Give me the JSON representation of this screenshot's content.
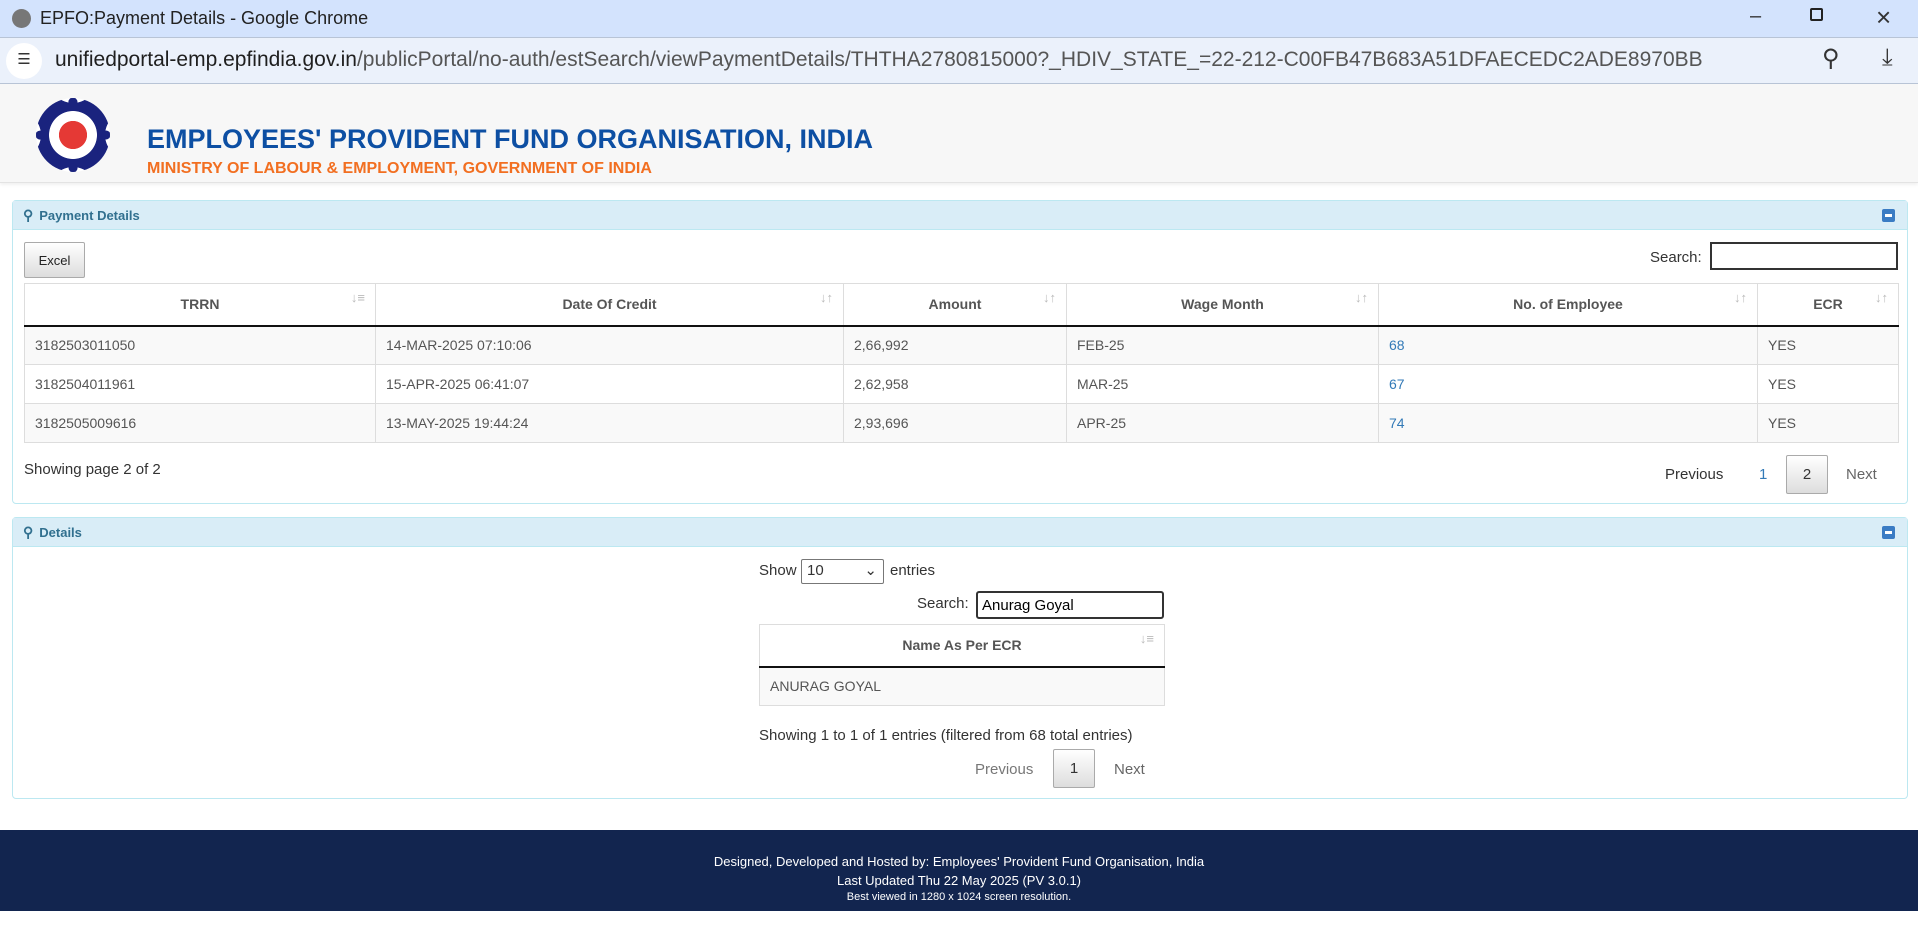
{
  "browser": {
    "title": "EPFO:Payment Details - Google Chrome",
    "url_host": "unifiedportal-emp.epfindia.gov.in",
    "url_path": "/publicPortal/no-auth/estSearch/viewPaymentDetails/THTHA2780815000?_HDIV_STATE_=22-212-C00FB47B683A51DFAECEDC2ADE8970BB"
  },
  "header": {
    "title": "EMPLOYEES' PROVIDENT FUND ORGANISATION, INDIA",
    "subtitle": "MINISTRY OF LABOUR & EMPLOYMENT, GOVERNMENT OF INDIA",
    "logo_text": "EPFO"
  },
  "payment": {
    "title": "Payment Details",
    "excel": "Excel",
    "search_label": "Search:",
    "search_value": "",
    "columns": [
      "TRRN",
      "Date Of Credit",
      "Amount",
      "Wage Month",
      "No. of Employee",
      "ECR"
    ],
    "rows": [
      [
        "3182503011050",
        "14-MAR-2025 07:10:06",
        "2,66,992",
        "FEB-25",
        "68",
        "YES"
      ],
      [
        "3182504011961",
        "15-APR-2025 06:41:07",
        "2,62,958",
        "MAR-25",
        "67",
        "YES"
      ],
      [
        "3182505009616",
        "13-MAY-2025 19:44:24",
        "2,93,696",
        "APR-25",
        "74",
        "YES"
      ]
    ],
    "info": "Showing page 2 of 2",
    "prev": "Previous",
    "pages": [
      "1",
      "2"
    ],
    "next": "Next"
  },
  "details": {
    "title": "Details",
    "show": "Show",
    "length": "10",
    "entries": "entries",
    "search_label": "Search:",
    "search_value": "Anurag Goyal",
    "column": "Name As Per ECR",
    "rows": [
      "ANURAG GOYAL"
    ],
    "info": "Showing 1 to 1 of 1 entries (filtered from 68 total entries)",
    "prev": "Previous",
    "page": "1",
    "next": "Next"
  },
  "footer": {
    "line1": "Designed, Developed and Hosted by: Employees' Provident Fund Organisation, India",
    "line2": "Last Updated Thu 22 May 2025 (PV 3.0.1)",
    "line3": "Best viewed in 1280 x 1024 screen resolution."
  }
}
